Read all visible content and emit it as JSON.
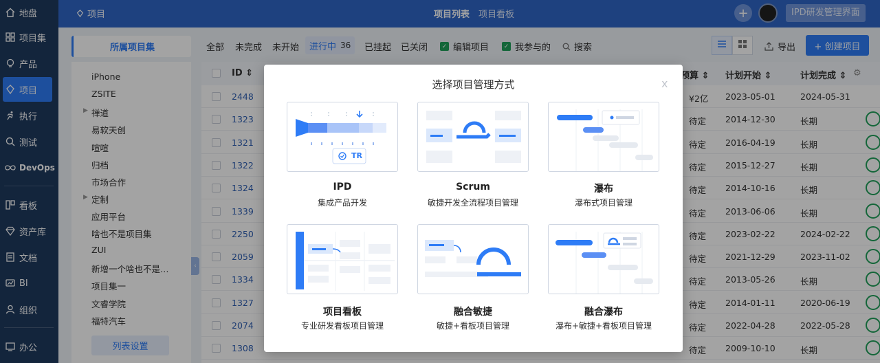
{
  "nav": {
    "items": [
      {
        "label": "地盘",
        "icon": "home-icon"
      },
      {
        "label": "项目集",
        "icon": "grid-icon"
      },
      {
        "label": "产品",
        "icon": "bulb-icon"
      },
      {
        "label": "项目",
        "icon": "project-icon"
      },
      {
        "label": "执行",
        "icon": "run-icon"
      },
      {
        "label": "测试",
        "icon": "test-icon"
      },
      {
        "label": "DevOps",
        "icon": "devops-icon"
      },
      {
        "label": "看板",
        "icon": "board-icon"
      },
      {
        "label": "资产库",
        "icon": "diamond-icon"
      },
      {
        "label": "文档",
        "icon": "doc-icon"
      },
      {
        "label": "BI",
        "icon": "bi-icon"
      },
      {
        "label": "组织",
        "icon": "org-icon"
      },
      {
        "label": "办公",
        "icon": "office-icon"
      }
    ],
    "active_index": 3
  },
  "topbar": {
    "breadcrumb": "项目",
    "tabs": [
      "项目列表",
      "项目看板"
    ],
    "active_tab": "项目列表",
    "switch_label": "IPD研发管理界面",
    "plus_label": "+"
  },
  "setpanel": {
    "title": "所属项目集",
    "items": [
      "iPhone",
      "ZSITE",
      "禅道",
      "易软天创",
      "喧喧",
      "归档",
      "市场合作",
      "定制",
      "应用平台",
      "啥也不是项目集",
      "ZUI",
      "新增一个啥也不是…",
      "项目集一",
      "文睿学院",
      "福特汽车"
    ],
    "settings_label": "列表设置"
  },
  "filters": {
    "tabs": [
      "全部",
      "未完成",
      "未开始",
      "进行中",
      "已挂起",
      "已关闭"
    ],
    "active_tab": "进行中",
    "active_count": "36",
    "checks": [
      "编辑项目",
      "我参与的"
    ],
    "search_label": "搜索",
    "export_label": "导出",
    "create_label": "+ 创建项目"
  },
  "table": {
    "headers": {
      "id": "ID",
      "budget": "预算",
      "plan_start": "计划开始",
      "plan_end": "计划完成"
    },
    "rows": [
      {
        "id": "2448",
        "budget": "¥2亿",
        "start": "2023-05-01",
        "end": "2024-05-31"
      },
      {
        "id": "1323",
        "budget": "待定",
        "start": "2014-12-30",
        "end": "长期"
      },
      {
        "id": "1321",
        "budget": "待定",
        "start": "2016-04-19",
        "end": "长期"
      },
      {
        "id": "1322",
        "budget": "待定",
        "start": "2015-12-27",
        "end": "长期"
      },
      {
        "id": "1324",
        "budget": "待定",
        "start": "2014-10-16",
        "end": "长期"
      },
      {
        "id": "1339",
        "budget": "待定",
        "start": "2013-06-06",
        "end": "长期"
      },
      {
        "id": "2250",
        "budget": "待定",
        "start": "2023-02-22",
        "end": "2024-02-22"
      },
      {
        "id": "2059",
        "budget": "待定",
        "start": "2021-12-29",
        "end": "2023-11-02"
      },
      {
        "id": "1334",
        "budget": "待定",
        "start": "2013-05-26",
        "end": "长期"
      },
      {
        "id": "1327",
        "budget": "待定",
        "start": "2014-01-11",
        "end": "2020-06-19"
      },
      {
        "id": "2074",
        "budget": "待定",
        "start": "2022-04-28",
        "end": "2022-05-28"
      },
      {
        "id": "1308",
        "budget": "待定",
        "start": "2009-10-10",
        "end": "长期"
      }
    ]
  },
  "modal": {
    "title": "选择项目管理方式",
    "close": "x",
    "badge": "TR",
    "cards": [
      {
        "title": "IPD",
        "desc": "集成产品开发"
      },
      {
        "title": "Scrum",
        "desc": "敏捷开发全流程项目管理"
      },
      {
        "title": "瀑布",
        "desc": "瀑布式项目管理"
      },
      {
        "title": "项目看板",
        "desc": "专业研发看板项目管理"
      },
      {
        "title": "融合敏捷",
        "desc": "敏捷+看板项目管理"
      },
      {
        "title": "融合瀑布",
        "desc": "瀑布+敏捷+看板项目管理"
      }
    ]
  },
  "colors": {
    "primary": "#2e7cf6",
    "nav_bg": "#1f3a5f",
    "top_bg": "#2f67c7",
    "success": "#20a05a"
  }
}
